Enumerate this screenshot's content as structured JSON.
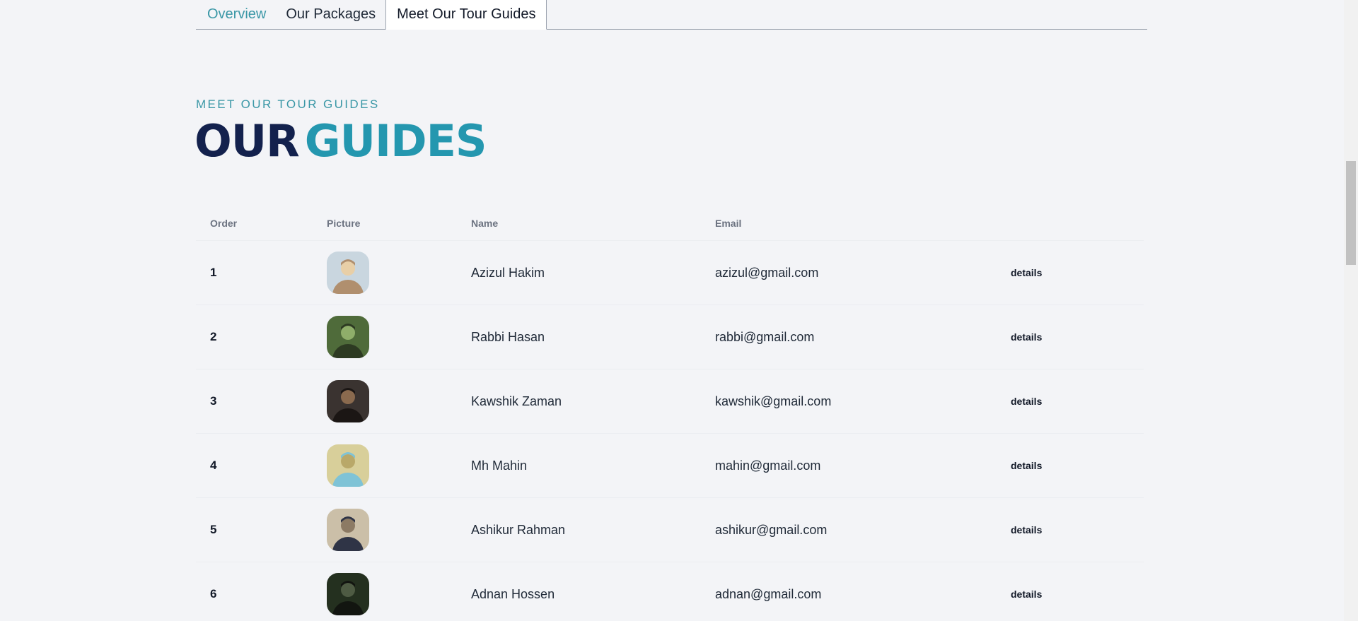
{
  "tabs": [
    {
      "label": "Overview"
    },
    {
      "label": "Our Packages"
    },
    {
      "label": "Meet Our Tour Guides"
    }
  ],
  "section": {
    "eyebrow": "MEET OUR TOUR GUIDES",
    "title_part1": "OUR",
    "title_part2": "GUIDES"
  },
  "table": {
    "columns": [
      "Order",
      "Picture",
      "Name",
      "Email",
      ""
    ],
    "rows": [
      {
        "order": "1",
        "name": "Azizul Hakim",
        "email": "azizul@gmail.com",
        "action": "details",
        "avatar": "guide-photo-icon"
      },
      {
        "order": "2",
        "name": "Rabbi Hasan",
        "email": "rabbi@gmail.com",
        "action": "details",
        "avatar": "guide-photo-icon"
      },
      {
        "order": "3",
        "name": "Kawshik Zaman",
        "email": "kawshik@gmail.com",
        "action": "details",
        "avatar": "guide-photo-icon"
      },
      {
        "order": "4",
        "name": "Mh Mahin",
        "email": "mahin@gmail.com",
        "action": "details",
        "avatar": "guide-photo-icon"
      },
      {
        "order": "5",
        "name": "Ashikur Rahman",
        "email": "ashikur@gmail.com",
        "action": "details",
        "avatar": "guide-photo-icon"
      },
      {
        "order": "6",
        "name": "Adnan Hossen",
        "email": "adnan@gmail.com",
        "action": "details",
        "avatar": "guide-photo-icon"
      }
    ]
  },
  "colors": {
    "accent": "#3a97a6",
    "title_dark": "#13214d",
    "title_accent": "#2497af",
    "background": "#f3f4f7"
  }
}
